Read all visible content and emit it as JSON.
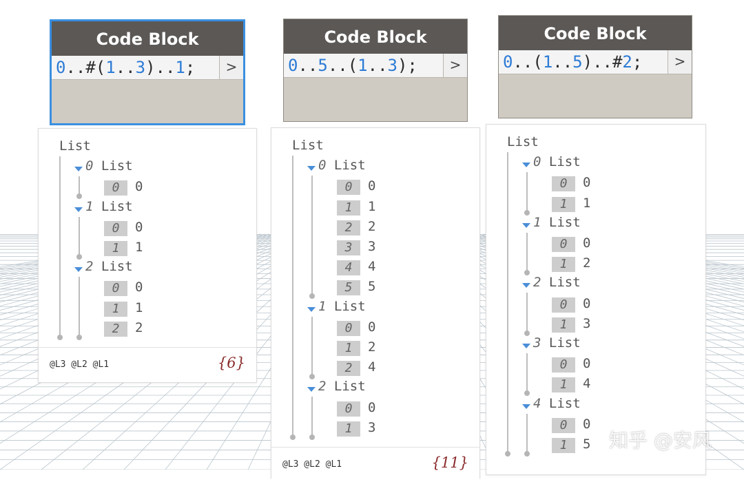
{
  "nodes": [
    {
      "header": "Code Block",
      "code": [
        {
          "t": "0",
          "n": true
        },
        {
          "t": "..#(",
          "n": false
        },
        {
          "t": "1",
          "n": true
        },
        {
          "t": "..",
          "n": false
        },
        {
          "t": "3",
          "n": true
        },
        {
          "t": ")..",
          "n": false
        },
        {
          "t": "1",
          "n": true
        },
        {
          "t": ";",
          "n": false
        }
      ],
      "run_label": ">",
      "selected": true
    },
    {
      "header": "Code Block",
      "code": [
        {
          "t": "0",
          "n": true
        },
        {
          "t": "..",
          "n": false
        },
        {
          "t": "5",
          "n": true
        },
        {
          "t": "..(",
          "n": false
        },
        {
          "t": "1",
          "n": true
        },
        {
          "t": "..",
          "n": false
        },
        {
          "t": "3",
          "n": true
        },
        {
          "t": ");",
          "n": false
        }
      ],
      "run_label": ">",
      "selected": false
    },
    {
      "header": "Code Block",
      "code": [
        {
          "t": "0",
          "n": true
        },
        {
          "t": "..(",
          "n": false
        },
        {
          "t": "1",
          "n": true
        },
        {
          "t": "..",
          "n": false
        },
        {
          "t": "5",
          "n": true
        },
        {
          "t": ")..#",
          "n": false
        },
        {
          "t": "2",
          "n": true
        },
        {
          "t": ";",
          "n": false
        }
      ],
      "run_label": ">",
      "selected": false
    }
  ],
  "previews": [
    {
      "root_label": "List",
      "sublist_word": "List",
      "sublists": [
        {
          "index": "0",
          "items": [
            [
              "0",
              "0"
            ]
          ]
        },
        {
          "index": "1",
          "items": [
            [
              "0",
              "0"
            ],
            [
              "1",
              "1"
            ]
          ]
        },
        {
          "index": "2",
          "items": [
            [
              "0",
              "0"
            ],
            [
              "1",
              "1"
            ],
            [
              "2",
              "2"
            ]
          ]
        }
      ],
      "levels": "@L3 @L2 @L1",
      "count": "{6}"
    },
    {
      "root_label": "List",
      "sublist_word": "List",
      "sublists": [
        {
          "index": "0",
          "items": [
            [
              "0",
              "0"
            ],
            [
              "1",
              "1"
            ],
            [
              "2",
              "2"
            ],
            [
              "3",
              "3"
            ],
            [
              "4",
              "4"
            ],
            [
              "5",
              "5"
            ]
          ]
        },
        {
          "index": "1",
          "items": [
            [
              "0",
              "0"
            ],
            [
              "1",
              "2"
            ],
            [
              "2",
              "4"
            ]
          ]
        },
        {
          "index": "2",
          "items": [
            [
              "0",
              "0"
            ],
            [
              "1",
              "3"
            ]
          ]
        }
      ],
      "levels": "@L3 @L2 @L1",
      "count": "{11}"
    },
    {
      "root_label": "List",
      "sublist_word": "List",
      "sublists": [
        {
          "index": "0",
          "items": [
            [
              "0",
              "0"
            ],
            [
              "1",
              "1"
            ]
          ]
        },
        {
          "index": "1",
          "items": [
            [
              "0",
              "0"
            ],
            [
              "1",
              "2"
            ]
          ]
        },
        {
          "index": "2",
          "items": [
            [
              "0",
              "0"
            ],
            [
              "1",
              "3"
            ]
          ]
        },
        {
          "index": "3",
          "items": [
            [
              "0",
              "0"
            ],
            [
              "1",
              "4"
            ]
          ]
        },
        {
          "index": "4",
          "items": [
            [
              "0",
              "0"
            ],
            [
              "1",
              "5"
            ]
          ]
        }
      ],
      "levels": "",
      "count": ""
    }
  ],
  "watermark": "知乎 @安风",
  "colors": {
    "selection": "#3a8fe0",
    "number_literal": "#2d7bd6",
    "node_header": "#5b5856",
    "node_body": "#cfcbc3",
    "count_text": "#8a2a2a",
    "expand_arrow": "#4a8ed8"
  }
}
